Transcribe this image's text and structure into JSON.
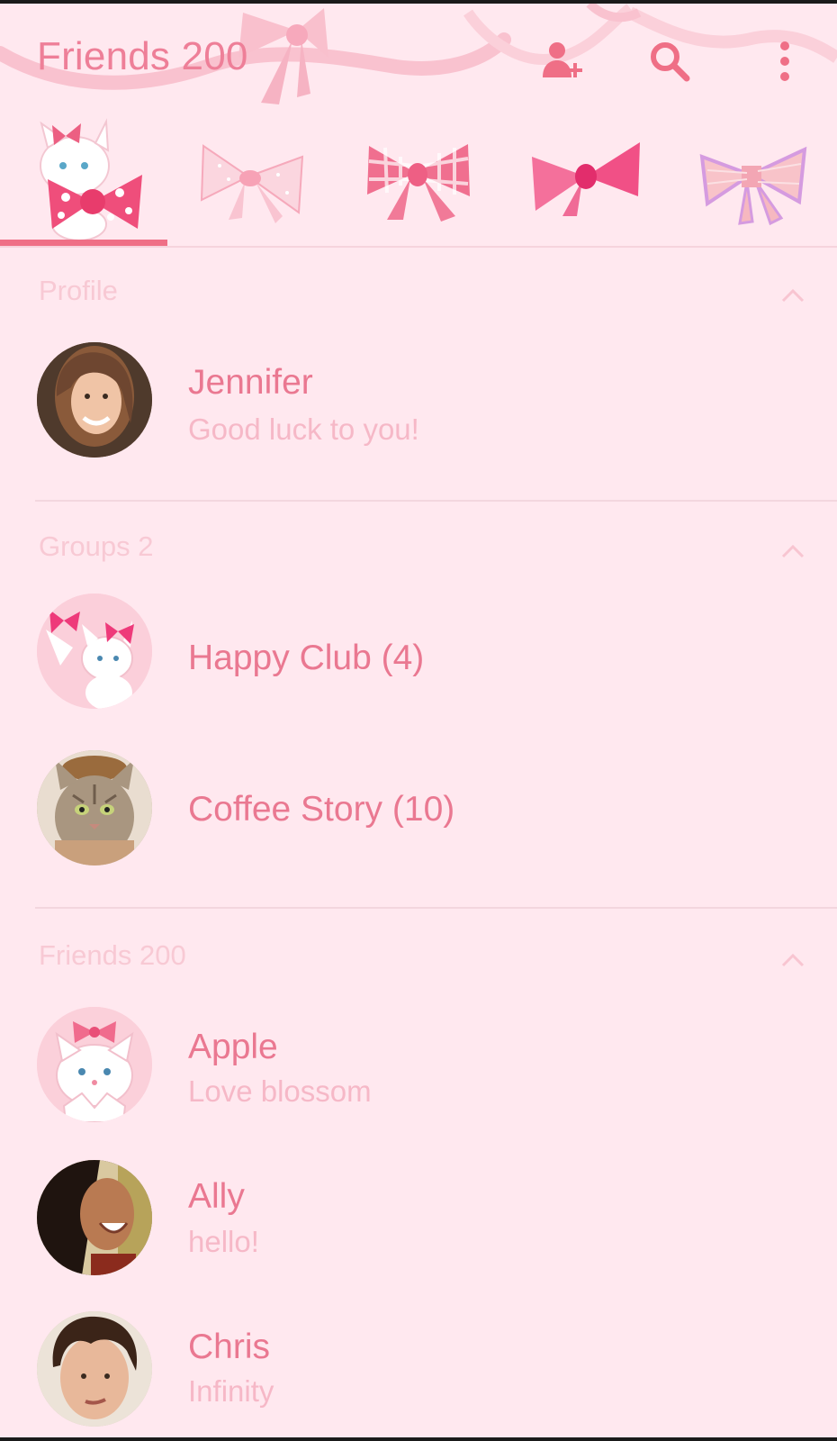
{
  "header": {
    "title": "Friends 200",
    "icons": [
      "add-friend-icon",
      "search-icon",
      "more-vert-icon"
    ]
  },
  "tabs": [
    {
      "name": "cat-bow-tab",
      "selected": true
    },
    {
      "name": "sheer-bow-tab",
      "selected": false
    },
    {
      "name": "gingham-bow-tab",
      "selected": false
    },
    {
      "name": "organza-bow-tab",
      "selected": false
    },
    {
      "name": "knit-bow-tab",
      "selected": false
    }
  ],
  "profile": {
    "header": "Profile",
    "name": "Jennifer",
    "status": "Good luck to you!"
  },
  "groups": {
    "header": "Groups 2",
    "items": [
      {
        "name": "Happy Club (4)"
      },
      {
        "name": "Coffee Story (10)"
      }
    ]
  },
  "friends": {
    "header": "Friends 200",
    "items": [
      {
        "name": "Apple",
        "status": "Love blossom"
      },
      {
        "name": "Ally",
        "status": "hello!"
      },
      {
        "name": "Chris",
        "status": "Infinity"
      }
    ]
  },
  "colors": {
    "background": "#ffe8ef",
    "accent": "#ef6f86",
    "text": "#ea7891",
    "muted": "#f6b8c7"
  }
}
